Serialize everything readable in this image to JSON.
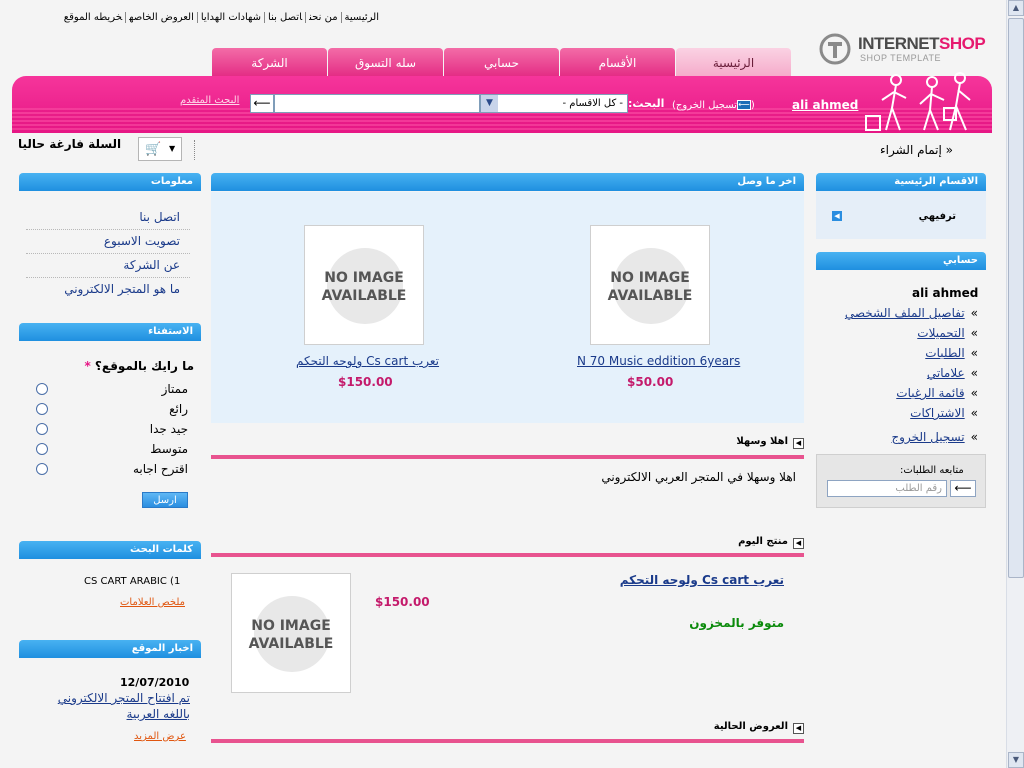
{
  "top_links": [
    "الرئيسية",
    "من نحن",
    "اتصل بنا",
    "شهادات الهدايا",
    "العروض الخاصه",
    "خريطه الموقع"
  ],
  "logo": {
    "brand_left": "INTERNET",
    "brand_right": "SHOP",
    "tagline": "SHOP TEMPLATE"
  },
  "tabs": [
    "الرئيسية",
    "الأقسام",
    "حسابي",
    "سله التسوق",
    "الشركة"
  ],
  "header": {
    "user": "ali ahmed",
    "logout": "تسجيل الخروج",
    "search_label": "البحث:",
    "category_selected": "- كل الاقسام -",
    "go": "⟵",
    "advanced": "البحث المتقدم"
  },
  "breadcrumb": "إتمام الشراء",
  "cart": {
    "empty_text": "السلة فارغة حاليا"
  },
  "left": {
    "info": {
      "title": "معلومات",
      "links": [
        "اتصل بنا",
        "تصويت الاسبوع",
        "عن الشركة",
        "ما هو المتجر الالكتروني"
      ]
    },
    "poll": {
      "title": "الاستفتاء",
      "question": "ما رايك بالموقع؟",
      "required_mark": "*",
      "options": [
        "ممتاز",
        "رائع",
        "جيد جدا",
        "متوسط",
        "اقترح اجابه"
      ],
      "submit": "ارسل"
    },
    "tags": {
      "title": "كلمات البحث",
      "index": "1)",
      "item": "CS CART ARABIC",
      "summary": "ملخص العلامات"
    },
    "news": {
      "title": "اخبار الموقع",
      "date": "12/07/2010",
      "text": "تم افتتاح المتجر الالكتروني باللغه العربية",
      "more": "عرض المزيد"
    }
  },
  "center": {
    "latest": {
      "title": "اخر ما وصل",
      "no_image_line1": "NO IMAGE",
      "no_image_line2": "AVAILABLE",
      "products": [
        {
          "name": "N 70 Music eddition 6years",
          "price": "$50.00"
        },
        {
          "name": "تعرب Cs cart ولوحه التحكم",
          "price": "$150.00"
        }
      ]
    },
    "welcome": {
      "title": "اهلا وسهلا",
      "text": "اهلا وسهلا في المتجر العربي الالكتروني"
    },
    "daily": {
      "title": "منتج اليوم",
      "name": "تعرب Cs cart ولوحه التحكم",
      "price": "$150.00",
      "stock": "متوفر بالمخزون"
    },
    "offers": {
      "title": "العروض الحالية"
    }
  },
  "right": {
    "categories": {
      "title": "الاقسام الرئيسية",
      "item": "ترفيهي"
    },
    "account": {
      "title": "حسابي",
      "user": "ali ahmed",
      "links": [
        "تفاصيل الملف الشخصي",
        "التحميلات",
        "الطلبات",
        "علاماتي",
        "قائمة الرغبات",
        "الاشتراكات",
        "تسجيل الخروج"
      ],
      "chevron": "»"
    },
    "tracking": {
      "label": "متابعه الطلبات:",
      "placeholder": "رقم الطلب",
      "go": "⟵"
    }
  },
  "colors": {
    "pink": "#e61785",
    "blue": "#1f8fe0",
    "price": "#c41a6b",
    "stock": "#0a8a0a"
  }
}
